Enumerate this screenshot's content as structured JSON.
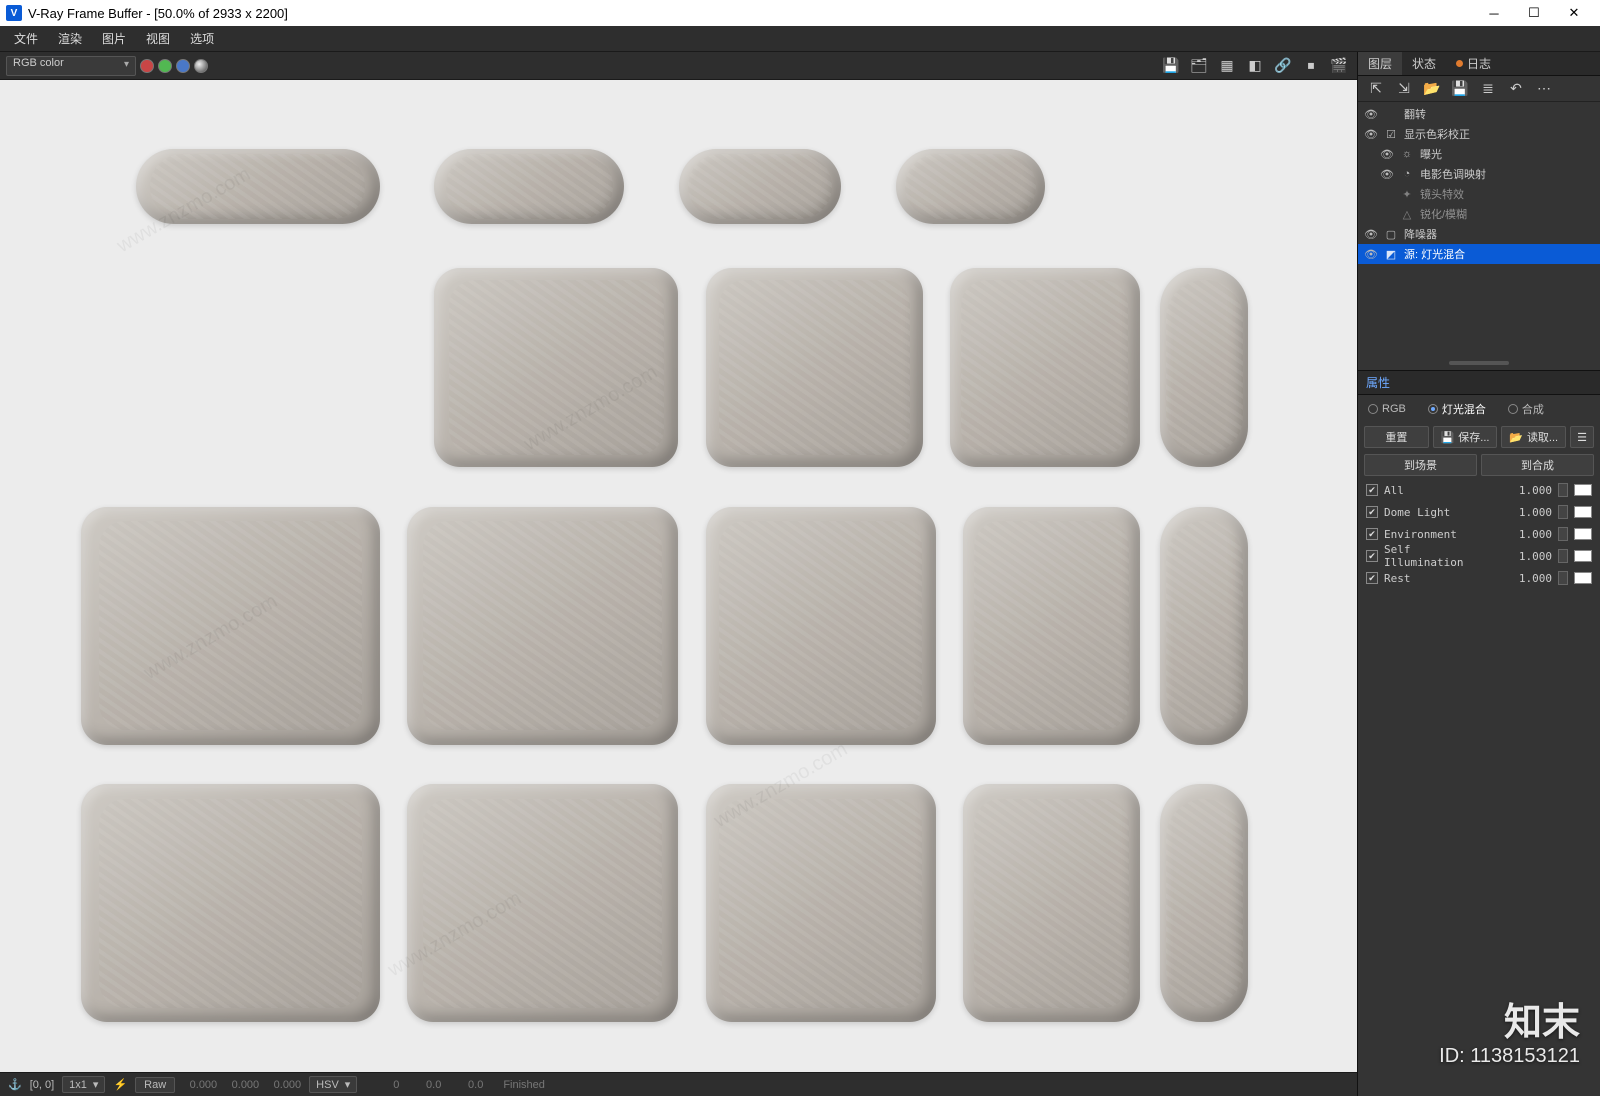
{
  "window": {
    "logo": "V",
    "title": "V-Ray Frame Buffer - [50.0% of 2933 x 2200]",
    "min": "─",
    "max": "☐",
    "close": "✕"
  },
  "menu": {
    "items": [
      "文件",
      "渲染",
      "图片",
      "视图",
      "选项"
    ]
  },
  "toolbar": {
    "channel": "RGB color",
    "icons": {
      "save": "💾",
      "history": "🗂",
      "region": "▦",
      "compare": "◧",
      "link": "🔗",
      "stop": "⏹",
      "render": "🎬"
    }
  },
  "statusbar": {
    "anchor": "⚓",
    "coords": "[0, 0]",
    "size": "1x1",
    "sizeDrop": "▾",
    "lin": "⚡",
    "rawLabel": "Raw",
    "r0": "0.000",
    "r1": "0.000",
    "r2": "0.000",
    "hsvLabel": "HSV",
    "hsvDrop": "▾",
    "h0": "0",
    "h1": "0.0",
    "h2": "0.0",
    "finished": "Finished"
  },
  "rtabs": {
    "layers": "图层",
    "status": "状态",
    "log": "日志"
  },
  "rtoolbar": {
    "a": "⇱",
    "b": "⇲",
    "c": "📂",
    "d": "💾",
    "e": "≣",
    "f": "↶",
    "g": "⋯"
  },
  "layers": {
    "l0": "翻转",
    "l1": "显示色彩校正",
    "l2": "曝光",
    "l3": "电影色调映射",
    "l4": "镜头特效",
    "l5": "锐化/模糊",
    "l6": "降噪器",
    "l7": "源: 灯光混合"
  },
  "props": {
    "header": "属性",
    "radios": {
      "rgb": "RGB",
      "lightmix": "灯光混合",
      "composite": "合成"
    },
    "btns": {
      "reset": "重置",
      "save": "保存...",
      "load": "读取...",
      "menu": "☰",
      "saveIcon": "💾",
      "loadIcon": "📂"
    },
    "btns2": {
      "toScene": "到场景",
      "toComposite": "到合成"
    },
    "rows": [
      {
        "name": "All",
        "val": "1.000"
      },
      {
        "name": "Dome Light",
        "val": "1.000"
      },
      {
        "name": "Environment",
        "val": "1.000"
      },
      {
        "name": "Self Illumination",
        "val": "1.000"
      },
      {
        "name": "Rest",
        "val": "1.000"
      }
    ],
    "check": "✔"
  },
  "watermark": {
    "brand": "知末",
    "id": "ID: 1138153121",
    "diag": "www.znzmo.com"
  }
}
